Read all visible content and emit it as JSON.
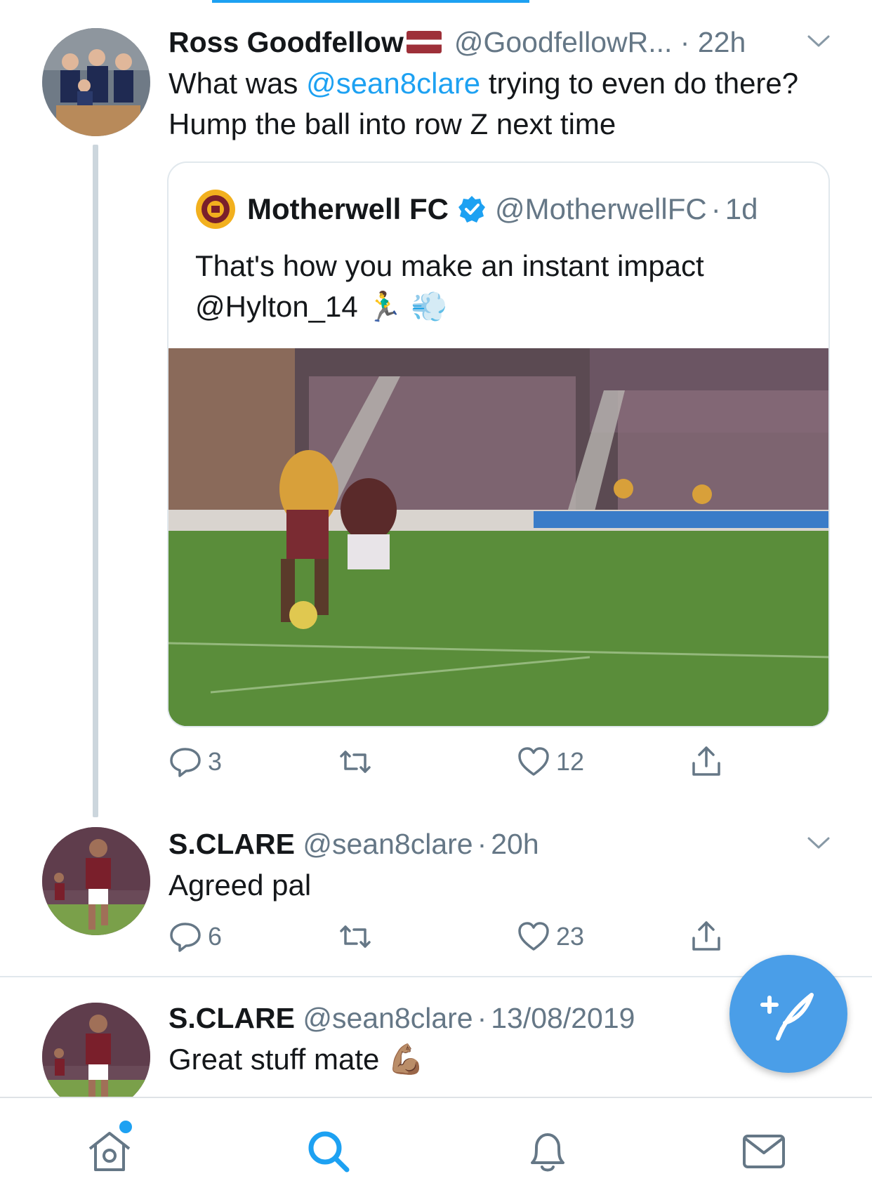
{
  "colors": {
    "accent": "#1da1f2",
    "fab": "#4a9ee8",
    "muted": "#657786",
    "border": "#e1e8ed"
  },
  "tweet1": {
    "name": "Ross Goodfellow",
    "handle": "@GoodfellowR...",
    "dot": "·",
    "time": "22h",
    "flag": "latvia-flag-emoji",
    "text_before": "What was ",
    "mention": "@sean8clare",
    "text_after": " trying to even do there? Hump the ball into row Z next time",
    "quote": {
      "name": "Motherwell FC",
      "verified": "verified-badge-icon",
      "handle": "@MotherwellFC",
      "dot": "·",
      "time": "1d",
      "text_line1": "That's how you make an instant impact",
      "text_line2": "@Hylton_14 🏃‍♂️ 💨",
      "media": "football-match-video-thumbnail"
    },
    "actions": {
      "replies": "3",
      "retweets": "",
      "likes": "12"
    }
  },
  "tweet2": {
    "name": "S.CLARE",
    "handle": "@sean8clare",
    "dot": "·",
    "time": "20h",
    "text": "Agreed pal",
    "actions": {
      "replies": "6",
      "retweets": "",
      "likes": "23"
    }
  },
  "tweet3": {
    "name": "S.CLARE",
    "handle": "@sean8clare",
    "dot": "·",
    "time": "13/08/2019",
    "text": "Great stuff mate 💪🏽"
  },
  "tabbar": {
    "home": "home-icon",
    "search": "search-icon",
    "notifications": "bell-icon",
    "messages": "mail-icon"
  },
  "fab": "compose-tweet-icon"
}
